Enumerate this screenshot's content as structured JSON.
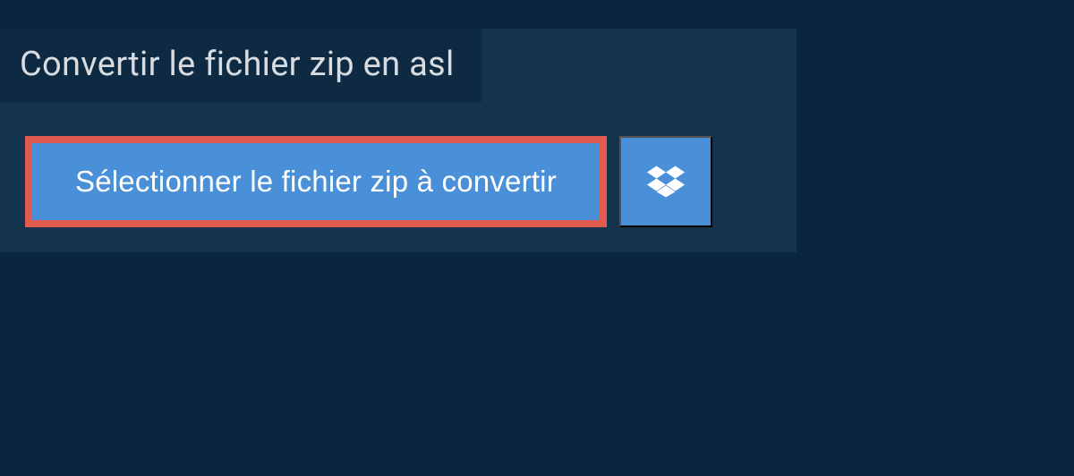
{
  "header": {
    "title": "Convertir le fichier zip en asl"
  },
  "actions": {
    "select_file_label": "Sélectionner le fichier zip à convertir",
    "dropbox_icon": "dropbox-icon"
  },
  "colors": {
    "page_bg": "#0a2540",
    "panel_bg": "#14334d",
    "heading_bg": "#0d2a42",
    "button_bg": "#4a90d9",
    "highlight_border": "#e05a4f",
    "text_light": "#d8dce0",
    "text_white": "#ffffff"
  }
}
